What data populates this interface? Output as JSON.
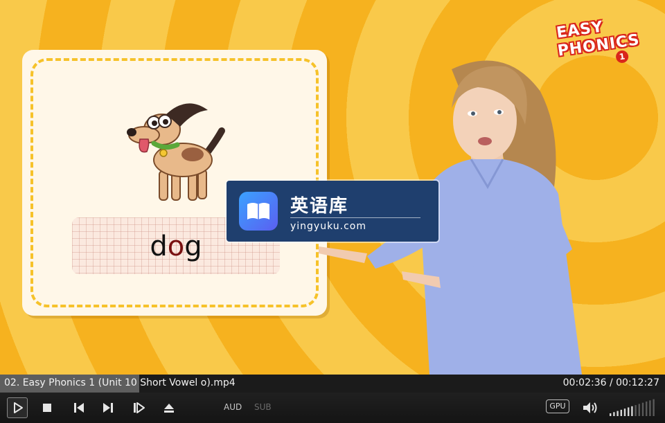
{
  "video": {
    "card": {
      "word_start": "d",
      "word_vowel": "o",
      "word_end": "g"
    },
    "logo": {
      "line1": "EASY",
      "line2": "PHONICS",
      "level": "1"
    },
    "watermark": {
      "title": "英语库",
      "url": "yingyuku.com"
    }
  },
  "player": {
    "file_name": "02. Easy Phonics 1 (Unit 10 Short Vowel o).mp4",
    "time": "00:02:36 / 00:12:27",
    "progress": 0.209,
    "audio_label": "AUD",
    "subtitle_label": "SUB",
    "gpu_label": "GPU",
    "volume_level": 0.5,
    "colors": {
      "background_stripe_dark": "#f6b21f",
      "background_stripe_light": "#f9c94a",
      "card_background": "#fff7e8",
      "card_dash": "#f6c22a",
      "vowel_highlight": "#7a1111",
      "logo_red": "#d9261c",
      "watermark_background": "#1f3f6e"
    }
  }
}
